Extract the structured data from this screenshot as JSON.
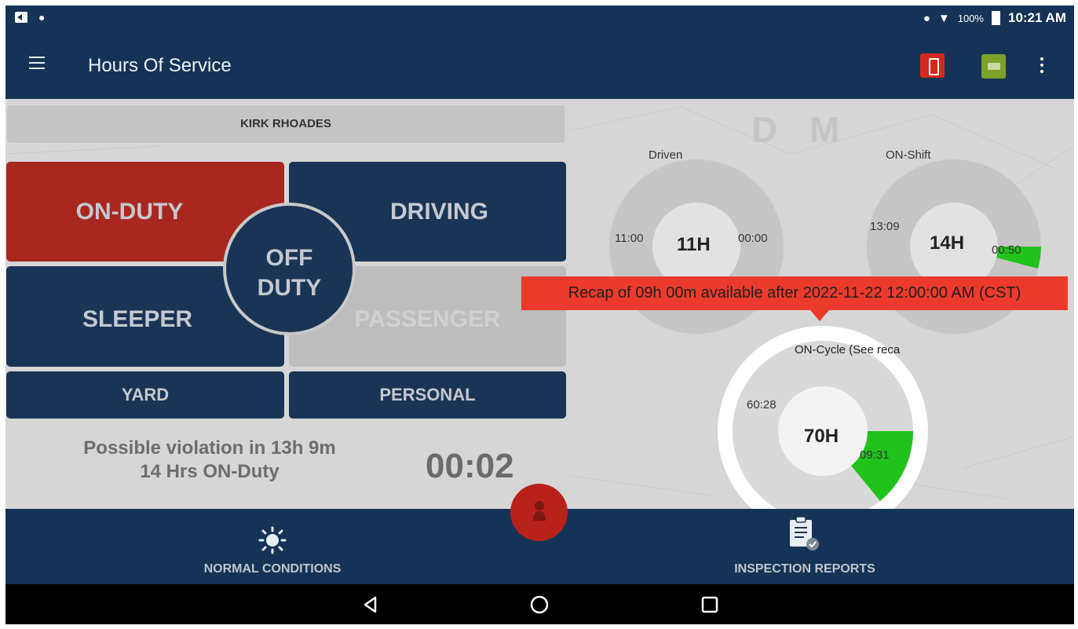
{
  "status_bar": {
    "battery": "100%",
    "time": "10:21 AM"
  },
  "app_bar": {
    "title": "Hours Of Service"
  },
  "driver": {
    "name": "KIRK RHOADES"
  },
  "duty_buttons": {
    "on_duty": "ON-DUTY",
    "driving": "DRIVING",
    "off_duty_line1": "OFF",
    "off_duty_line2": "DUTY",
    "sleeper": "SLEEPER",
    "passenger": "PASSENGER",
    "yard": "YARD",
    "personal": "PERSONAL"
  },
  "violation": {
    "line1": "Possible violation in 13h 9m",
    "line2": "14 Hrs ON-Duty",
    "timer": "00:02"
  },
  "logo": "D M",
  "gauges": {
    "driven": {
      "label": "Driven",
      "left": "11:00",
      "center": "11H",
      "right": "00:00"
    },
    "on_shift": {
      "label": "ON-Shift",
      "left": "13:09",
      "center": "14H",
      "right": "00:50"
    },
    "on_cycle": {
      "label": "ON-Cycle (See reca",
      "left": "60:28",
      "center": "70H",
      "right": "09:31"
    }
  },
  "recap_banner": "Recap of 09h 00m available after 2022-11-22 12:00:00 AM (CST)",
  "bottom_nav": {
    "normal_conditions": "NORMAL CONDITIONS",
    "inspection_reports": "INSPECTION REPORTS"
  },
  "colors": {
    "primary": "#153356",
    "on_duty": "#a8281f",
    "banner": "#ec3b2c",
    "used_segment": "#22c21d"
  }
}
